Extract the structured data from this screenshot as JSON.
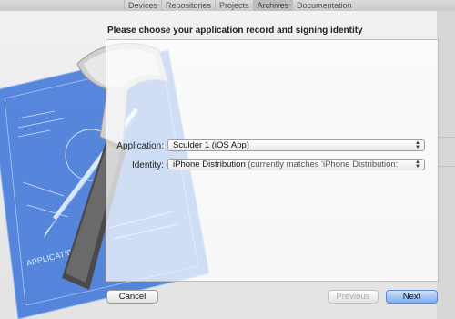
{
  "toolbar": {
    "tabs": [
      {
        "label": "Devices"
      },
      {
        "label": "Repositories"
      },
      {
        "label": "Projects"
      },
      {
        "label": "Archives"
      },
      {
        "label": "Documentation"
      }
    ],
    "selected_tab": "Archives"
  },
  "dialog": {
    "title": "Please choose your application record and signing identity",
    "application": {
      "label": "Application:",
      "value": "Sculder 1 (iOS App)"
    },
    "identity": {
      "label": "Identity:",
      "value": "iPhone Distribution",
      "suffix": "(currently matches 'iPhone Distribution:"
    },
    "buttons": {
      "cancel": "Cancel",
      "previous": "Previous",
      "next": "Next"
    }
  },
  "artwork": {
    "caption": "APPLICATION APP"
  },
  "colors": {
    "accent": "#6f9fe6",
    "blueprint": "#3b74d8"
  }
}
